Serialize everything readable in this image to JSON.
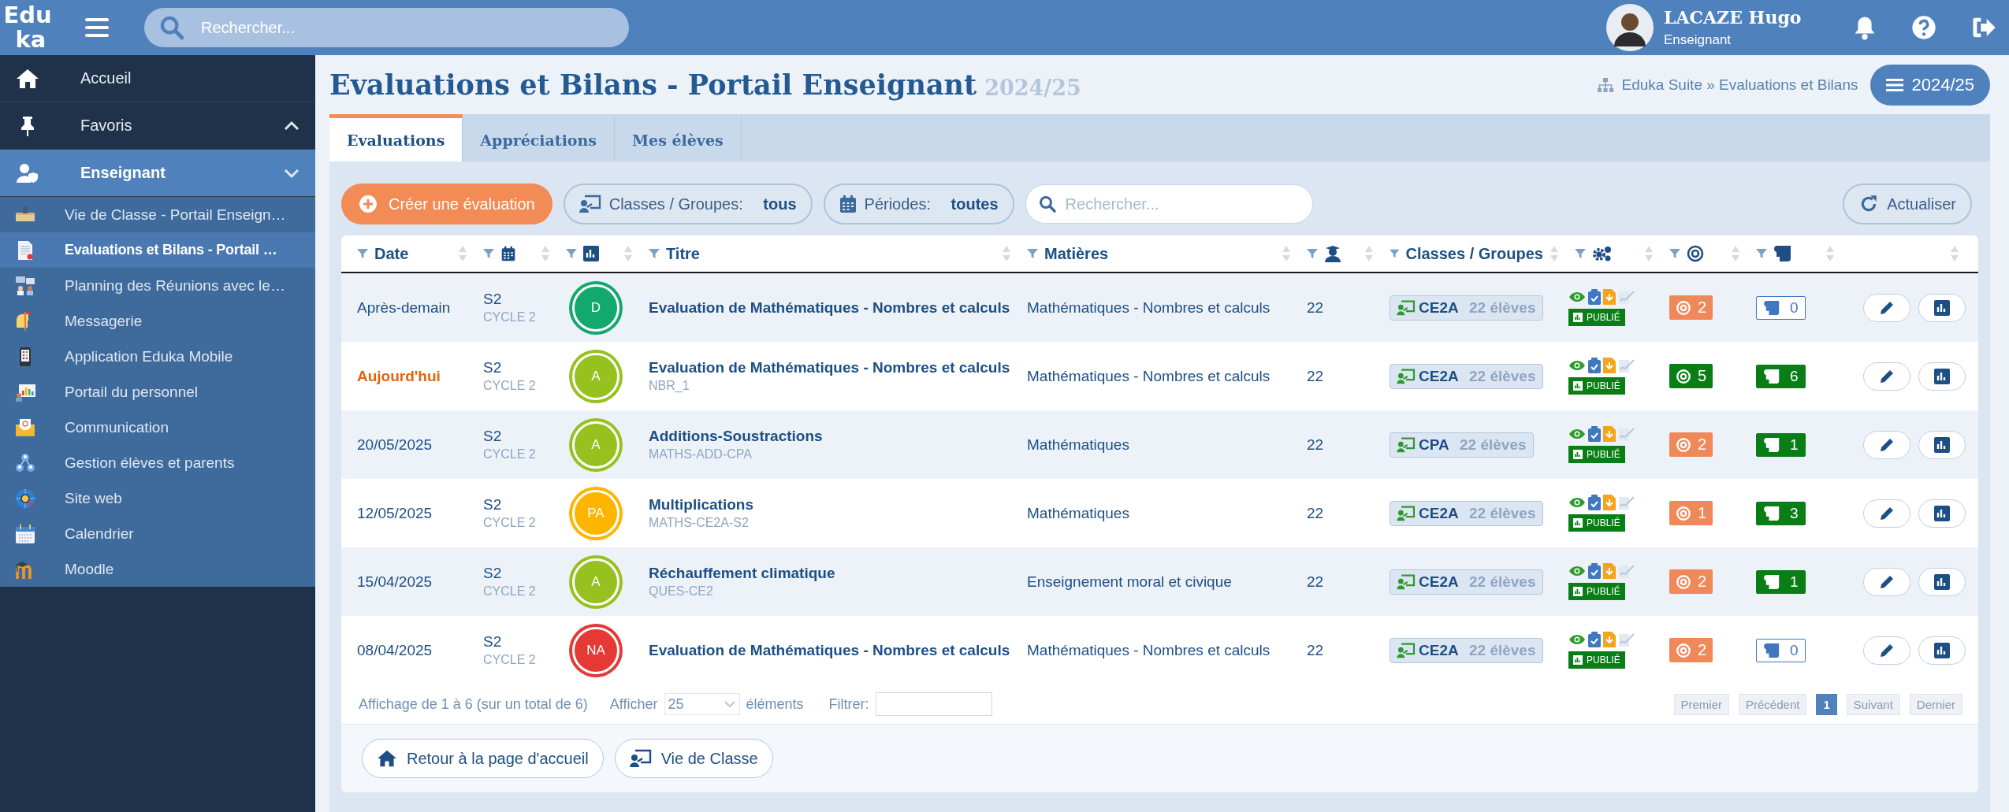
{
  "topbar": {
    "logo": [
      "Edu",
      "ka"
    ],
    "search": {
      "placeholder": "Rechercher..."
    },
    "user": {
      "name": "LACAZE Hugo",
      "role": "Enseignant"
    }
  },
  "sidebar": {
    "items": [
      {
        "label": "Accueil",
        "kind": "link"
      },
      {
        "label": "Favoris",
        "kind": "group",
        "expanded": false
      },
      {
        "label": "Enseignant",
        "kind": "group",
        "expanded": true,
        "children": [
          {
            "label": "Vie de Classe - Portail Enseign…",
            "selected": false
          },
          {
            "label": "Evaluations et Bilans - Portail …",
            "selected": true
          },
          {
            "label": "Planning des Réunions avec le…",
            "selected": false
          },
          {
            "label": "Messagerie",
            "selected": false
          },
          {
            "label": "Application Eduka Mobile",
            "selected": false
          },
          {
            "label": "Portail du personnel",
            "selected": false
          },
          {
            "label": "Communication",
            "selected": false
          },
          {
            "label": "Gestion élèves et parents",
            "selected": false
          },
          {
            "label": "Site web",
            "selected": false
          },
          {
            "label": "Calendrier",
            "selected": false
          },
          {
            "label": "Moodle",
            "selected": false
          }
        ]
      }
    ]
  },
  "page": {
    "title": "Evaluations et Bilans - Portail Enseignant",
    "year": "2024/25",
    "breadcrumb": "Eduka Suite » Evaluations et Bilans",
    "year_button": "2024/25"
  },
  "tabs": [
    {
      "label": "Evaluations",
      "selected": true
    },
    {
      "label": "Appréciations",
      "selected": false
    },
    {
      "label": "Mes élèves",
      "selected": false
    }
  ],
  "toolbar": {
    "create": "Créer une évaluation",
    "filters": [
      {
        "label": "Classes / Groupes:",
        "value": "tous"
      },
      {
        "label": "Périodes:",
        "value": "toutes"
      }
    ],
    "search": {
      "placeholder": "Rechercher..."
    },
    "refresh": "Actualiser"
  },
  "table": {
    "columns": [
      "Date",
      "Titre",
      "Matières",
      "Classes / Groupes"
    ],
    "rows": [
      {
        "date": "Après-demain",
        "highlighted": false,
        "period": "S2",
        "cycle": "CYCLE 2",
        "grade": {
          "text": "D",
          "color": "#13a86e"
        },
        "title": "Evaluation de Mathématiques - Nombres et calculs",
        "subject": "Mathématiques - Nombres et calculs",
        "students": "22",
        "class": {
          "name": "CE2A",
          "count": "22 élèves"
        },
        "status": "PUBLIÉ",
        "targets": {
          "value": "2",
          "color": "#f0895a"
        },
        "comments": {
          "value": "0",
          "filled": false
        }
      },
      {
        "date": "Aujourd'hui",
        "highlighted": true,
        "period": "S2",
        "cycle": "CYCLE 2",
        "grade": {
          "text": "A",
          "color": "#96c11f"
        },
        "title": "Evaluation de Mathématiques - Nombres et calculs",
        "code": "NBR_1",
        "subject": "Mathématiques - Nombres et calculs",
        "students": "22",
        "class": {
          "name": "CE2A",
          "count": "22 élèves"
        },
        "status": "PUBLIÉ",
        "targets": {
          "value": "5",
          "color": "#0a7e16"
        },
        "comments": {
          "value": "6",
          "filled": true
        }
      },
      {
        "date": "20/05/2025",
        "highlighted": false,
        "period": "S2",
        "cycle": "CYCLE 2",
        "grade": {
          "text": "A",
          "color": "#96c11f"
        },
        "title": "Additions-Soustractions",
        "code": "MATHS-ADD-CPA",
        "subject": "Mathématiques",
        "students": "22",
        "class": {
          "name": "CPA",
          "count": "22 élèves"
        },
        "status": "PUBLIÉ",
        "targets": {
          "value": "2",
          "color": "#f0895a"
        },
        "comments": {
          "value": "1",
          "filled": true
        }
      },
      {
        "date": "12/05/2025",
        "highlighted": false,
        "period": "S2",
        "cycle": "CYCLE 2",
        "grade": {
          "text": "PA",
          "color": "#fdb500"
        },
        "title": "Multiplications",
        "code": "MATHS-CE2A-S2",
        "subject": "Mathématiques",
        "students": "22",
        "class": {
          "name": "CE2A",
          "count": "22 élèves"
        },
        "status": "PUBLIÉ",
        "targets": {
          "value": "1",
          "color": "#f0895a"
        },
        "comments": {
          "value": "3",
          "filled": true
        }
      },
      {
        "date": "15/04/2025",
        "highlighted": false,
        "period": "S2",
        "cycle": "CYCLE 2",
        "grade": {
          "text": "A",
          "color": "#96c11f"
        },
        "title": "Réchauffement climatique",
        "code": "QUES-CE2",
        "subject": "Enseignement moral et civique",
        "students": "22",
        "class": {
          "name": "CE2A",
          "count": "22 élèves"
        },
        "status": "PUBLIÉ",
        "targets": {
          "value": "2",
          "color": "#f0895a"
        },
        "comments": {
          "value": "1",
          "filled": true
        }
      },
      {
        "date": "08/04/2025",
        "highlighted": false,
        "period": "S2",
        "cycle": "CYCLE 2",
        "grade": {
          "text": "NA",
          "color": "#e53935"
        },
        "title": "Evaluation de Mathématiques - Nombres et calculs",
        "subject": "Mathématiques - Nombres et calculs",
        "students": "22",
        "class": {
          "name": "CE2A",
          "count": "22 élèves"
        },
        "status": "PUBLIÉ",
        "targets": {
          "value": "2",
          "color": "#f0895a"
        },
        "comments": {
          "value": "0",
          "filled": false
        }
      }
    ]
  },
  "footer": {
    "info": "Affichage de 1 à 6 (sur un total de 6)",
    "show_label": "Afficher",
    "page_size": "25",
    "show_suffix": "éléments",
    "filter_label": "Filtrer:",
    "pages": [
      {
        "label": "Premier",
        "selected": false
      },
      {
        "label": "Précédent",
        "selected": false
      },
      {
        "label": "1",
        "selected": true
      },
      {
        "label": "Suivant",
        "selected": false
      },
      {
        "label": "Dernier",
        "selected": false
      }
    ]
  },
  "bottom_buttons": [
    "Retour à la page d'accueil",
    "Vie de Classe"
  ]
}
